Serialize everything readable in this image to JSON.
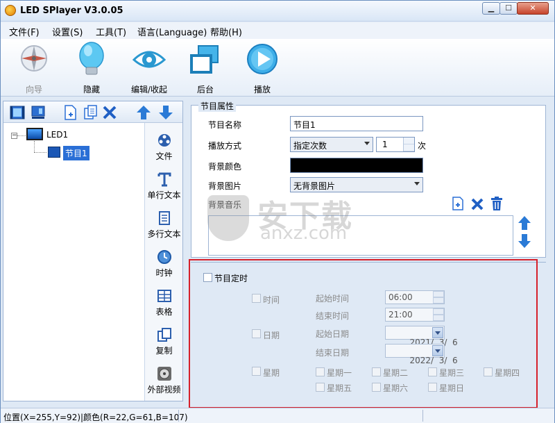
{
  "window": {
    "title": "LED SPlayer V3.0.05",
    "min_label": "▁",
    "max_label": "☐",
    "close_label": "✕"
  },
  "menu": [
    "文件(F)",
    "设置(S)",
    "工具(T)",
    "语言(Language)",
    "帮助(H)"
  ],
  "toolbar": {
    "wizard": "向导",
    "hide": "隐藏",
    "edit_collapse": "编辑/收起",
    "background": "后台",
    "play": "播放"
  },
  "tree": {
    "screen": "LED1",
    "program": "节目1",
    "expander": "−"
  },
  "side_tools": [
    "文件",
    "单行文本",
    "多行文本",
    "时钟",
    "表格",
    "复制",
    "外部视频"
  ],
  "program_props": {
    "group_title": "节目属性",
    "name_label": "节目名称",
    "name_value": "节目1",
    "play_mode_label": "播放方式",
    "play_mode_value": "指定次数",
    "play_count": "1",
    "count_unit": "次",
    "bg_color_label": "背景颜色",
    "bg_color_value": "#000000",
    "bg_image_label": "背景图片",
    "bg_image_value": "无背景图片",
    "bg_music_label": "背景音乐"
  },
  "schedule": {
    "title": "节目定时",
    "time_label": "时间",
    "start_time_label": "起始时间",
    "start_time": "06:00",
    "end_time_label": "结束时间",
    "end_time": "21:00",
    "date_label": "日期",
    "start_date_label": "起始日期",
    "start_date": "2021/  3/  6",
    "end_date_label": "结束日期",
    "end_date": "2022/  3/  6",
    "week_label": "星期",
    "days": [
      "星期一",
      "星期二",
      "星期三",
      "星期四",
      "星期五",
      "星期六",
      "星期日"
    ]
  },
  "status": {
    "text": "位置(X=255,Y=92)|颜色(R=22,G=61,B=107)"
  },
  "watermark": {
    "cn": "安下载",
    "en": "anxz.com"
  },
  "colors": {
    "accent": "#2a6fd6",
    "highlight_box": "#d6202a",
    "panel_bg": "#dfe9f5"
  }
}
